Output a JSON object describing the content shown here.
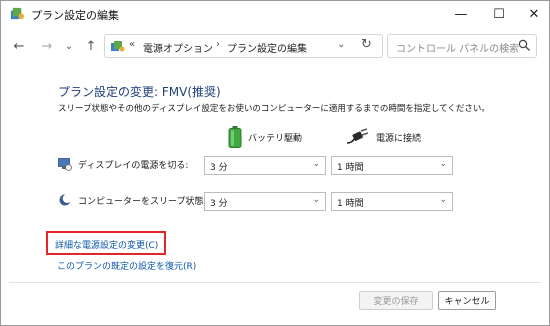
{
  "window": {
    "title": "プラン設定の編集",
    "controls": {
      "minimize": "—",
      "maximize": "☐",
      "close": "✕"
    }
  },
  "nav": {
    "back": "←",
    "forward": "→",
    "recent": "⌄",
    "up": "↑",
    "address": {
      "overflow": "«",
      "crumb1": "電源オプション",
      "sep": "›",
      "crumb2": "プラン設定の編集",
      "dropdown": "⌄",
      "refresh": "↻"
    },
    "search": {
      "placeholder": "コントロール パネルの検索"
    }
  },
  "main": {
    "heading": "プラン設定の変更: FMV(推奨)",
    "description": "スリープ状態やその他のディスプレイ設定をお使いのコンピューターに適用するまでの時間を指定してください。",
    "columns": {
      "battery": "バッテリ駆動",
      "plugged": "電源に接続"
    },
    "rows": [
      {
        "label": "ディスプレイの電源を切る:",
        "battery_value": "3 分",
        "plugged_value": "1 時間"
      },
      {
        "label": "コンピューターをスリープ状態にする:",
        "battery_value": "3 分",
        "plugged_value": "1 時間"
      }
    ],
    "links": {
      "advanced": "詳細な電源設定の変更(C)",
      "restore": "このプランの既定の設定を復元(R)"
    }
  },
  "footer": {
    "save": "変更の保存",
    "cancel": "キャンセル"
  },
  "colors": {
    "heading": "#1e3f7a",
    "link": "#0b57a8",
    "highlight": "#e3262b",
    "battery_green": "#3fa83f"
  }
}
